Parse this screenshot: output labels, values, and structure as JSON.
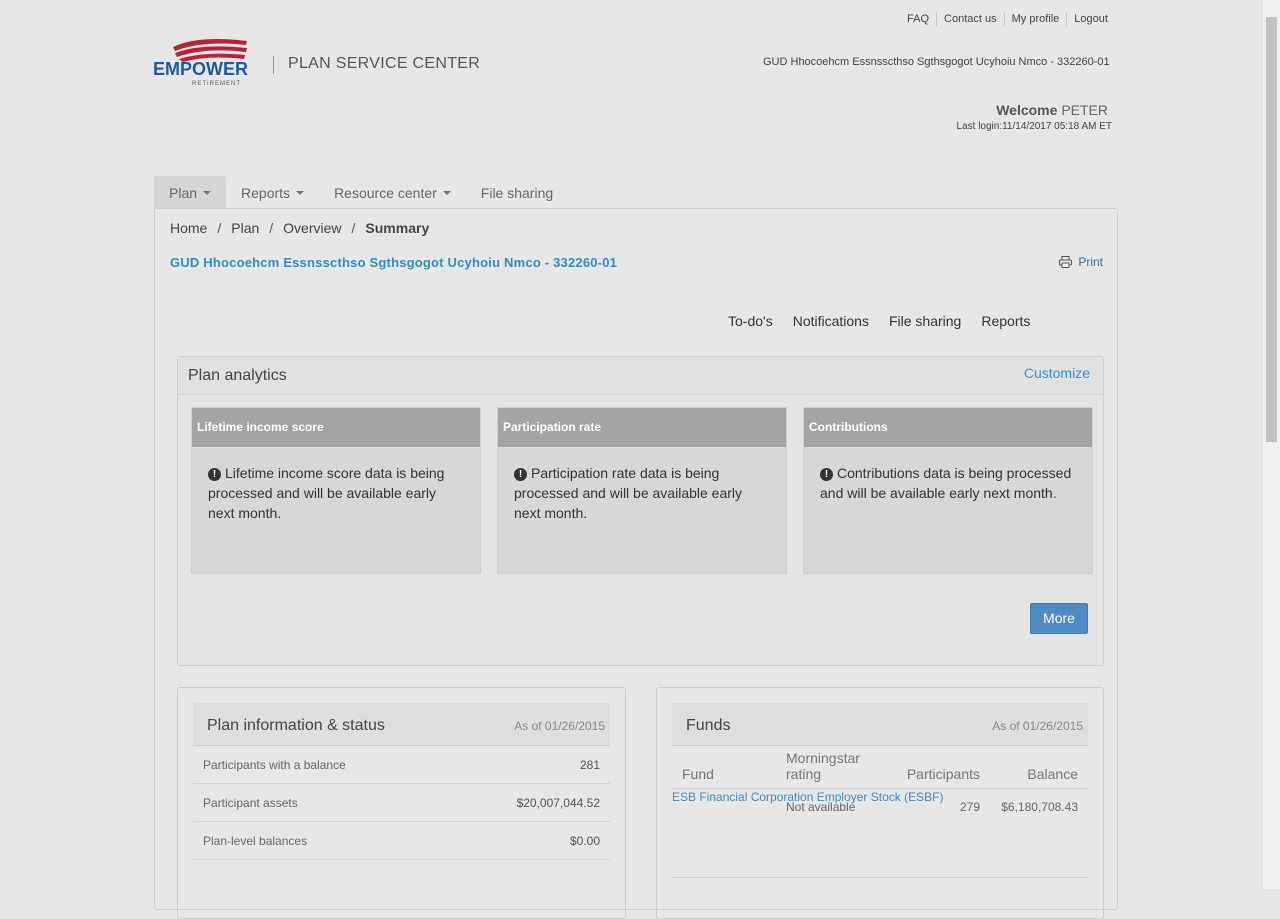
{
  "top_links": [
    "FAQ",
    "Contact us",
    "My profile",
    "Logout"
  ],
  "logo": {
    "word": "EMPOWER",
    "sub": "RETIREMENT",
    "brand_blue": "#1f5a9c",
    "brand_red": "#b6243a"
  },
  "app_title": "PLAN SERVICE CENTER",
  "plan_name_header": "GUD Hhocoehcm Essnsscthso Sgthsgogot Ucyhoiu Nmco - 332260-01",
  "welcome": {
    "label": "Welcome",
    "name": "PETER",
    "last_login": "Last login:11/14/2017 05:18 AM ET"
  },
  "nav": [
    {
      "label": "Plan",
      "dropdown": true,
      "active": true
    },
    {
      "label": "Reports",
      "dropdown": true
    },
    {
      "label": "Resource center",
      "dropdown": true
    },
    {
      "label": "File sharing",
      "dropdown": false
    }
  ],
  "breadcrumb": {
    "items": [
      "Home",
      "Plan",
      "Overview"
    ],
    "current": "Summary",
    "separator": "/"
  },
  "plan_title": "GUD Hhocoehcm Essnsscthso Sgthsgogot Ucyhoiu Nmco - 332260-01",
  "print_label": "Print",
  "subnav": [
    "To-do's",
    "Notifications",
    "File sharing",
    "Reports"
  ],
  "analytics": {
    "title": "Plan analytics",
    "customize": "Customize",
    "cards": [
      {
        "title": "Lifetime income score",
        "message": "Lifetime income score data is being processed and will be available early next month."
      },
      {
        "title": "Participation rate",
        "message": "Participation rate data is being processed and will be available early next month."
      },
      {
        "title": "Contributions",
        "message": "Contributions data is being processed and will be available early next month."
      }
    ],
    "more": "More"
  },
  "plan_info": {
    "title": "Plan information & status",
    "as_of": "As of 01/26/2015",
    "rows": [
      {
        "label": "Participants with a balance",
        "value": "281"
      },
      {
        "label": "Participant assets",
        "value": "$20,007,044.52"
      },
      {
        "label": "Plan-level balances",
        "value": "$0.00"
      }
    ]
  },
  "funds": {
    "title": "Funds",
    "as_of": "As of 01/26/2015",
    "columns": {
      "fund": "Fund",
      "rating": "Morningstar rating",
      "participants": "Participants",
      "balance": "Balance"
    },
    "rows": [
      {
        "fund": "ESB Financial Corporation Employer Stock (ESBF)",
        "rating": "Not available",
        "participants": "279",
        "balance": "$6,180,708.43"
      }
    ]
  }
}
